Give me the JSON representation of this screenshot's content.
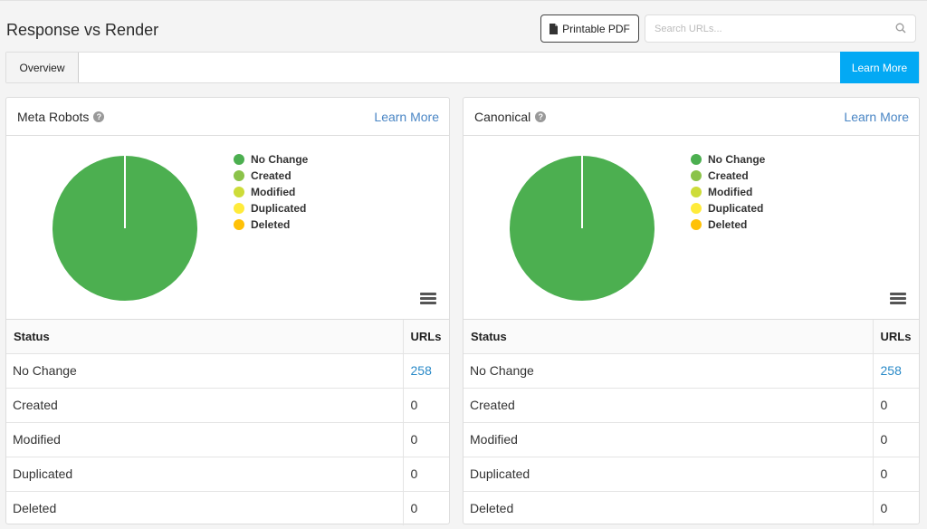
{
  "page": {
    "title": "Response vs Render",
    "printable_pdf": "Printable PDF",
    "search_placeholder": "Search URLs..."
  },
  "tabs": {
    "overview": "Overview",
    "learn_more": "Learn More"
  },
  "colors": {
    "accent": "#03a9f4",
    "link": "#4a86c5",
    "no_change": "#4caf50",
    "created": "#8bc34a",
    "modified": "#cddc39",
    "duplicated": "#ffeb3b",
    "deleted": "#ffc107"
  },
  "panels": [
    {
      "title": "Meta Robots",
      "learn_more": "Learn More",
      "legend": [
        "No Change",
        "Created",
        "Modified",
        "Duplicated",
        "Deleted"
      ],
      "table": {
        "headers": [
          "Status",
          "URLs"
        ],
        "rows": [
          {
            "status": "No Change",
            "urls": "258"
          },
          {
            "status": "Created",
            "urls": "0"
          },
          {
            "status": "Modified",
            "urls": "0"
          },
          {
            "status": "Duplicated",
            "urls": "0"
          },
          {
            "status": "Deleted",
            "urls": "0"
          }
        ]
      }
    },
    {
      "title": "Canonical",
      "learn_more": "Learn More",
      "legend": [
        "No Change",
        "Created",
        "Modified",
        "Duplicated",
        "Deleted"
      ],
      "table": {
        "headers": [
          "Status",
          "URLs"
        ],
        "rows": [
          {
            "status": "No Change",
            "urls": "258"
          },
          {
            "status": "Created",
            "urls": "0"
          },
          {
            "status": "Modified",
            "urls": "0"
          },
          {
            "status": "Duplicated",
            "urls": "0"
          },
          {
            "status": "Deleted",
            "urls": "0"
          }
        ]
      }
    }
  ],
  "chart_data": [
    {
      "type": "pie",
      "title": "Meta Robots",
      "categories": [
        "No Change",
        "Created",
        "Modified",
        "Duplicated",
        "Deleted"
      ],
      "values": [
        258,
        0,
        0,
        0,
        0
      ],
      "legend": "right"
    },
    {
      "type": "pie",
      "title": "Canonical",
      "categories": [
        "No Change",
        "Created",
        "Modified",
        "Duplicated",
        "Deleted"
      ],
      "values": [
        258,
        0,
        0,
        0,
        0
      ],
      "legend": "right"
    }
  ]
}
